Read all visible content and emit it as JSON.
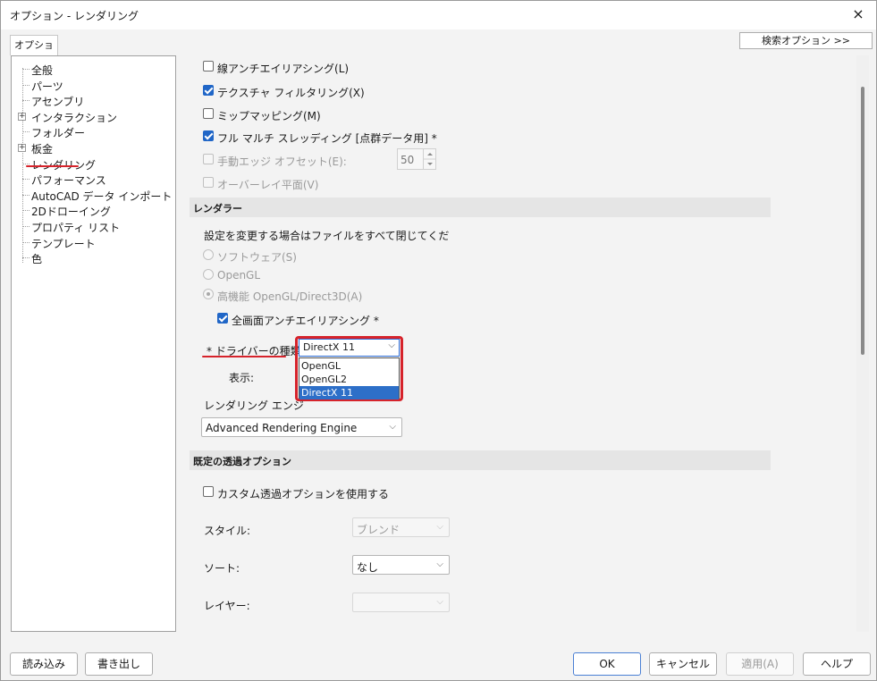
{
  "window": {
    "title": "オプション - レンダリング",
    "close_label": "×"
  },
  "tab_label": "オプション",
  "search_options_label": "検索オプション >>",
  "tree": {
    "items": [
      {
        "label": "全般",
        "expandable": false
      },
      {
        "label": "パーツ",
        "expandable": false
      },
      {
        "label": "アセンブリ",
        "expandable": false
      },
      {
        "label": "インタラクション",
        "expandable": true
      },
      {
        "label": "フォルダー",
        "expandable": false
      },
      {
        "label": "板金",
        "expandable": true
      },
      {
        "label": "レンダリング",
        "expandable": false,
        "selected": true
      },
      {
        "label": "パフォーマンス",
        "expandable": false
      },
      {
        "label": "AutoCAD データ インポート",
        "expandable": false
      },
      {
        "label": "2Dドローイング",
        "expandable": false
      },
      {
        "label": "プロパティ リスト",
        "expandable": false
      },
      {
        "label": "テンプレート",
        "expandable": false
      },
      {
        "label": "色",
        "expandable": false
      }
    ]
  },
  "checkboxes": {
    "line_antialias": {
      "label": "線アンチエイリアシング(L)",
      "checked": false
    },
    "texture_filter": {
      "label": "テクスチャ フィルタリング(X)",
      "checked": true
    },
    "mipmap": {
      "label": "ミップマッピング(M)",
      "checked": false
    },
    "full_multithread": {
      "label": "フル マルチ スレッディング [点群データ用] *",
      "checked": true
    },
    "manual_edge_offset": {
      "label": "手動エッジ オフセット(E):",
      "checked": false
    },
    "overlay_plane": {
      "label": "オーバーレイ平面(V)",
      "checked": false
    }
  },
  "edge_offset_value": "50",
  "renderer": {
    "section_title": "レンダラー",
    "note": "設定を変更する場合はファイルをすべて閉じてくだ",
    "radios": [
      {
        "label": "ソフトウェア(S)",
        "selected": false
      },
      {
        "label": "OpenGL",
        "selected": false
      },
      {
        "label": "高機能 OpenGL/Direct3D(A)",
        "selected": true
      }
    ],
    "fullscreen_aa": {
      "label": "全画面アンチエイリアシング *",
      "checked": true
    },
    "driver_label": "* ドライバーの種類:",
    "driver_value": "DirectX 11",
    "driver_options": [
      "OpenGL",
      "OpenGL2",
      "DirectX 11"
    ],
    "driver_selected_index": 2,
    "display_label": "表示:",
    "engine_label": "レンダリング エンジ",
    "engine_value": "Advanced Rendering Engine"
  },
  "transparency": {
    "section_title": "既定の透過オプション",
    "custom": {
      "label": "カスタム透過オプションを使用する",
      "checked": false
    },
    "style_label": "スタイル:",
    "style_value": "ブレンド",
    "sort_label": "ソート:",
    "sort_value": "なし",
    "layer_label": "レイヤー:",
    "layer_value": ""
  },
  "buttons": {
    "import": "読み込み",
    "export": "書き出し",
    "ok": "OK",
    "cancel": "キャンセル",
    "apply": "適用(A)",
    "help": "ヘルプ"
  },
  "colors": {
    "accent": "#2066c7",
    "highlight_red": "#d6232b",
    "selection": "#2d6fc8"
  }
}
